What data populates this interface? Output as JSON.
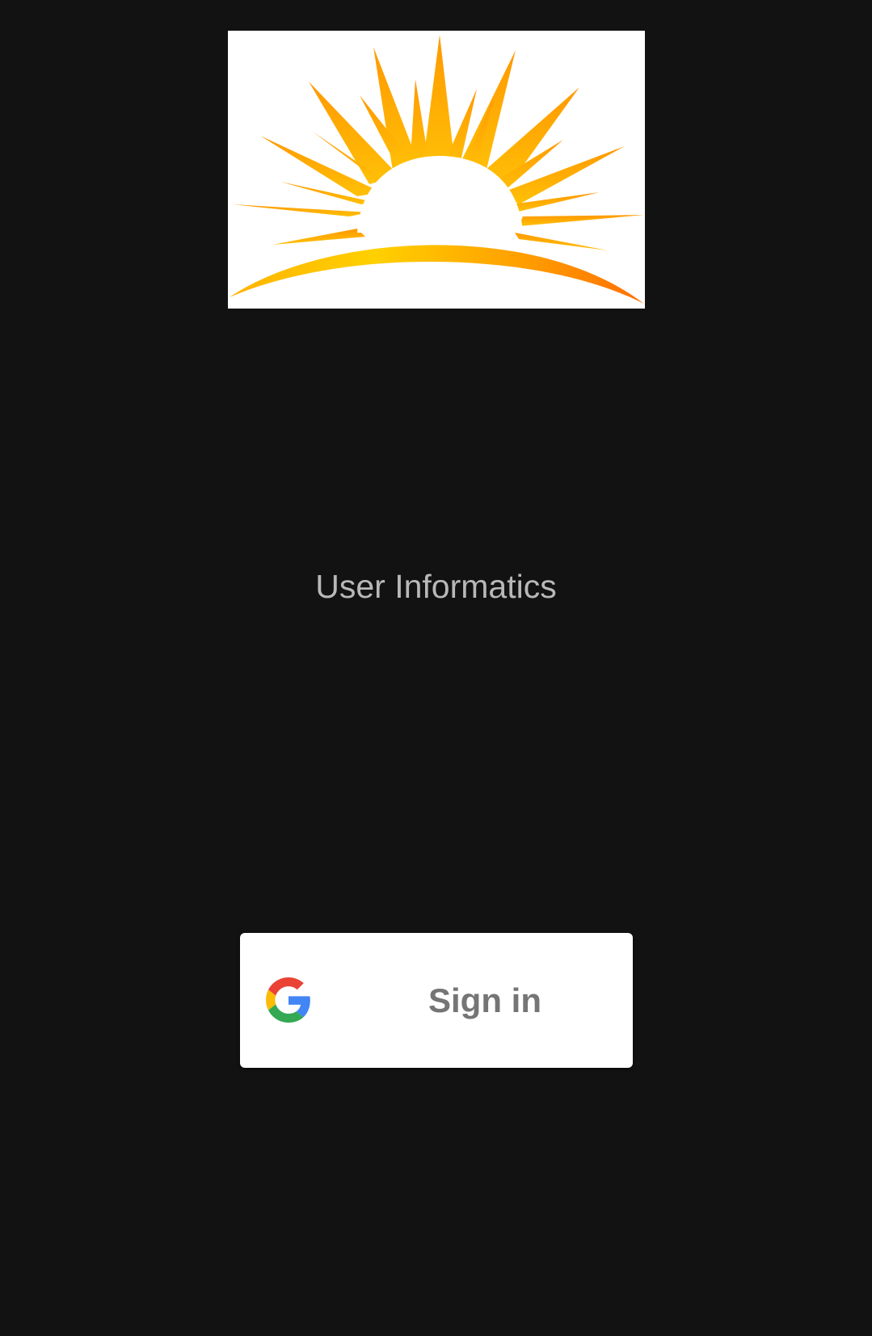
{
  "app": {
    "title": "User Informatics"
  },
  "logo": {
    "icon": "sunrise-logo",
    "colors": {
      "ray_light": "#FFC107",
      "ray_dark": "#FF8F00",
      "arc_light": "#FFD000",
      "arc_dark": "#FF6F00",
      "background": "#FFFFFF"
    }
  },
  "signin": {
    "label": "Sign in",
    "icon": "google-g-icon",
    "colors": {
      "blue": "#4285F4",
      "red": "#EA4335",
      "yellow": "#FBBC05",
      "green": "#34A853",
      "text": "#757575"
    }
  },
  "theme": {
    "background": "#121212",
    "title_color": "#B8B8B8"
  }
}
